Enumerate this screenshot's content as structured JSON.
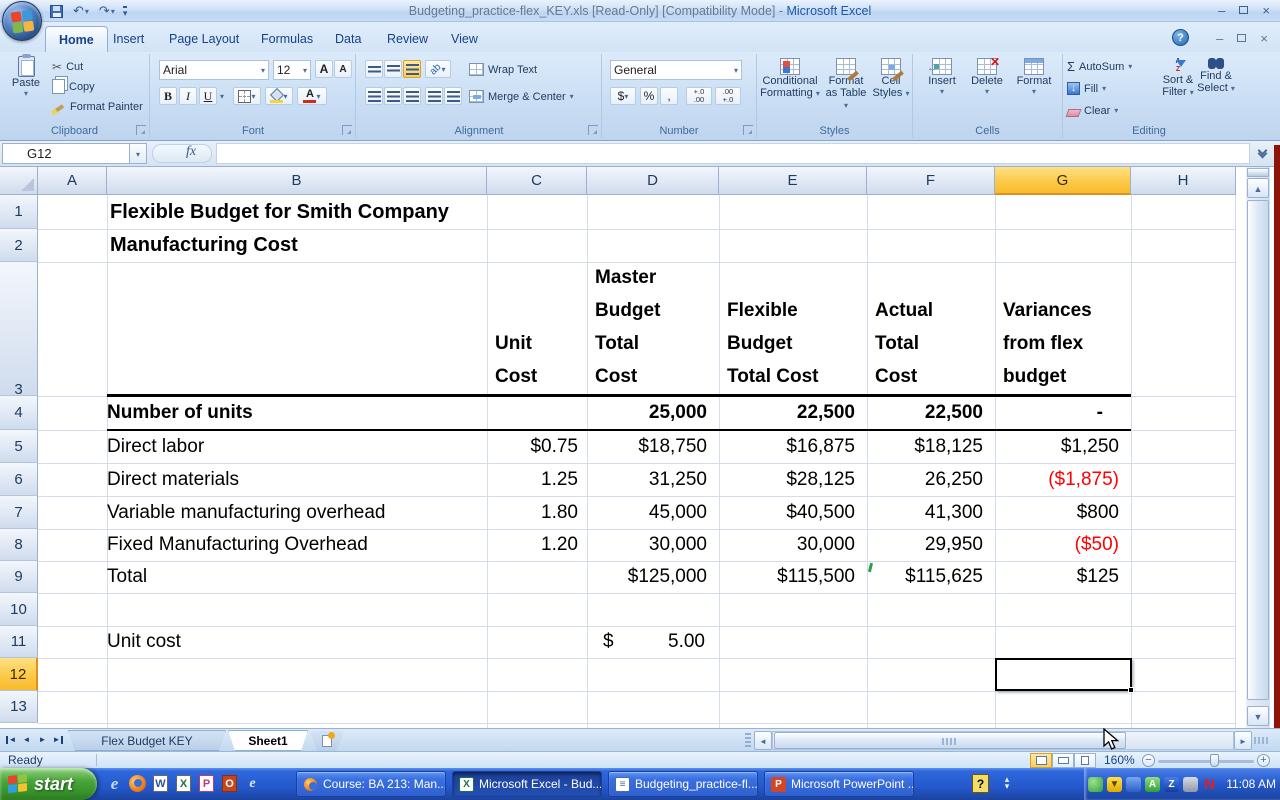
{
  "colors": {
    "negative_value": "#FF0000",
    "selection_header_fill": "#FCC845",
    "gridline": "#D4DCE9",
    "taskbar_blue": "#2458CC",
    "start_green": "#37922A",
    "title_blue": "#1C57A9"
  },
  "icons": {
    "dropdown": "▾",
    "cut": "✂",
    "undo": "↶",
    "redo": "↷",
    "sigma": "Σ",
    "fx": "fx",
    "help": "?",
    "close": "×",
    "minimize": "–",
    "left_arrow": "◄",
    "right_arrow": "►",
    "up_arrow": "▲",
    "down_arrow": "▼",
    "dollar": "$",
    "percent": "%",
    "comma": ",",
    "minus": "−",
    "plus": "+",
    "letter_a_big": "A",
    "letter_a_small": "A",
    "orientation": "ab",
    "inc_decimal": "+.0 .00",
    "dec_decimal": ".00 +.0",
    "sort_a": "A",
    "sort_z": "Z",
    "fill_arrow": "↓"
  },
  "title_bar": {
    "document": "Budgeting_practice-flex_KEY.xls  [Read-Only]  [Compatibility Mode] - ",
    "app": "Microsoft Excel"
  },
  "ribbon": {
    "tabs": [
      {
        "label": "Home"
      },
      {
        "label": "Insert"
      },
      {
        "label": "Page Layout"
      },
      {
        "label": "Formulas"
      },
      {
        "label": "Data"
      },
      {
        "label": "Review"
      },
      {
        "label": "View"
      }
    ],
    "clipboard": {
      "label": "Clipboard",
      "paste": "Paste",
      "cut": "Cut",
      "copy": "Copy",
      "format_painter": "Format Painter"
    },
    "font": {
      "label": "Font",
      "name": "Arial",
      "size": "12",
      "bold": "B",
      "italic": "I",
      "underline": "U"
    },
    "alignment": {
      "label": "Alignment",
      "wrap": "Wrap Text",
      "merge": "Merge & Center"
    },
    "number": {
      "label": "Number",
      "format": "General"
    },
    "styles": {
      "label": "Styles",
      "conditional_1": "Conditional",
      "conditional_2": "Formatting",
      "table_1": "Format",
      "table_2": "as Table",
      "cellstyles_1": "Cell",
      "cellstyles_2": "Styles"
    },
    "cells": {
      "label": "Cells",
      "insert": "Insert",
      "delete": "Delete",
      "format": "Format"
    },
    "editing": {
      "label": "Editing",
      "autosum": "AutoSum",
      "fill": "Fill",
      "clear": "Clear",
      "sort_1": "Sort &",
      "sort_2": "Filter",
      "find_1": "Find &",
      "find_2": "Select"
    }
  },
  "formula_bar": {
    "name_box": "G12"
  },
  "grid": {
    "columns": [
      "A",
      "B",
      "C",
      "D",
      "E",
      "F",
      "G",
      "H"
    ],
    "selected_column": "G",
    "rows": [
      "1",
      "2",
      "3",
      "4",
      "5",
      "6",
      "7",
      "8",
      "9",
      "10",
      "11",
      "12",
      "13"
    ],
    "selected_row": "12"
  },
  "sheet": {
    "title1": "Flexible Budget for Smith Company",
    "title2": "Manufacturing Cost",
    "headers": {
      "unit": "Unit\nCost",
      "master": "Master\nBudget\nTotal\nCost",
      "flexible": "Flexible\nBudget\nTotal Cost",
      "actual": "Actual\nTotal\nCost",
      "variance": "Variances\nfrom flex\nbudget"
    },
    "rows": [
      {
        "label": "Number of units",
        "unit": "",
        "master": "25,000",
        "flexible": "22,500",
        "actual": "22,500",
        "variance": "-"
      },
      {
        "label": "Direct labor",
        "unit": "$0.75",
        "master": "$18,750",
        "flexible": "$16,875",
        "actual": "$18,125",
        "variance": "$1,250"
      },
      {
        "label": "Direct materials",
        "unit": "1.25",
        "master": "31,250",
        "flexible": "$28,125",
        "actual": "26,250",
        "variance": "($1,875)",
        "negative": true
      },
      {
        "label": "Variable manufacturing overhead",
        "unit": "1.80",
        "master": "45,000",
        "flexible": "$40,500",
        "actual": "41,300",
        "variance": "$800"
      },
      {
        "label": "Fixed Manufacturing Overhead",
        "unit": "1.20",
        "master": "30,000",
        "flexible": "30,000",
        "actual": "29,950",
        "variance": "($50)",
        "negative": true
      },
      {
        "label": "Total",
        "unit": "",
        "master": "$125,000",
        "flexible": "$115,500",
        "actual": "$115,625",
        "variance": "$125"
      }
    ],
    "unit_cost": {
      "label": "Unit cost",
      "symbol": "$",
      "value": "5.00"
    }
  },
  "sheet_tabs": {
    "tab1": "Flex Budget KEY",
    "tab2": "Sheet1"
  },
  "status_bar": {
    "mode": "Ready",
    "zoom": "160%"
  },
  "taskbar": {
    "start": "start",
    "buttons": [
      {
        "label": "Course: BA 213: Man..."
      },
      {
        "label": "Microsoft Excel - Bud..."
      },
      {
        "label": "Budgeting_practice-fl..."
      },
      {
        "label": "Microsoft PowerPoint ..."
      }
    ],
    "clock": "11:08 AM"
  }
}
